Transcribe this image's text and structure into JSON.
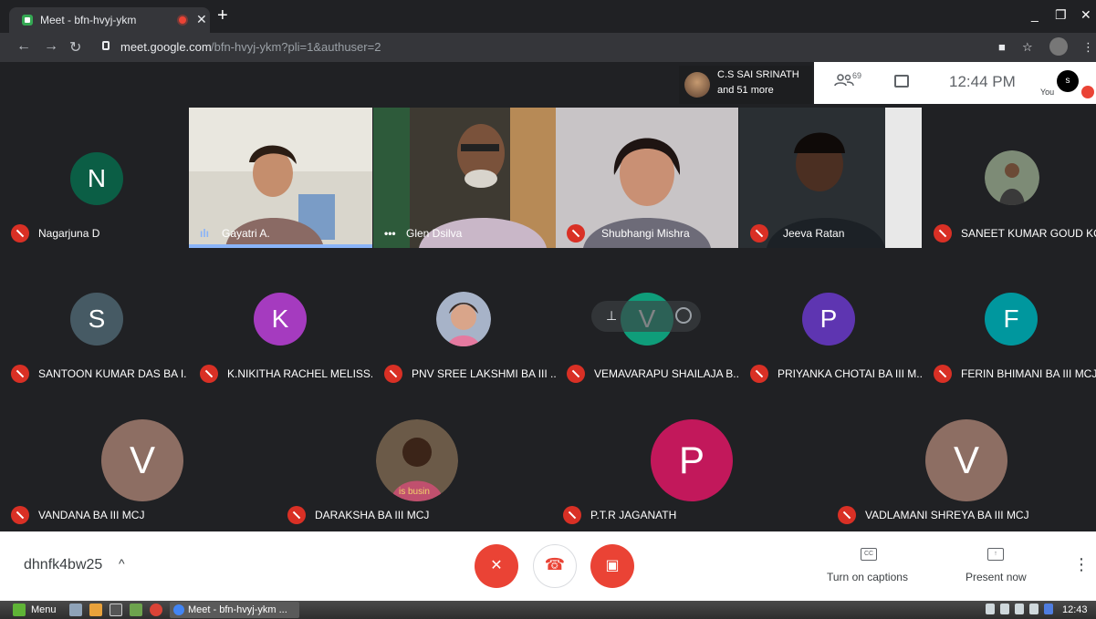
{
  "browser": {
    "tab_title": "Meet - bfn-hvyj-ykm",
    "url_host": "meet.google.com",
    "url_path": "/bfn-hvyj-ykm?pli=1&authuser=2"
  },
  "header": {
    "speaker_name": "C.S SAI SRINATH",
    "speaker_more": "and 51 more",
    "people_count": "69",
    "time": "12:44 PM",
    "you_label": "You",
    "self_initial": "s"
  },
  "participants": [
    {
      "name": "Nagarjuna D",
      "initial": "N",
      "color": "#0b5e45"
    },
    {
      "name": "Gayatri A.",
      "video": true,
      "speaking": true
    },
    {
      "name": "Glen Dsilva",
      "video": true
    },
    {
      "name": "Shubhangi Mishra",
      "video": true
    },
    {
      "name": "Jeeva Ratan",
      "video": true
    },
    {
      "name": "SANEET KUMAR GOUD KO...",
      "photo": true
    },
    {
      "name": "SANTOON KUMAR DAS BA I...",
      "initial": "S",
      "color": "#465a64"
    },
    {
      "name": "K.NIKITHA RACHEL MELISS...",
      "initial": "K",
      "color": "#a53bbf"
    },
    {
      "name": "PNV SREE LAKSHMI BA III ...",
      "photo": true
    },
    {
      "name": "VEMAVARAPU SHAILAJA B...",
      "initial": "V",
      "color": "#0f9d7a"
    },
    {
      "name": "PRIYANKA CHOTAI BA III M...",
      "initial": "P",
      "color": "#5e35b1"
    },
    {
      "name": "FERIN BHIMANI BA III MCJ",
      "initial": "F",
      "color": "#00979e"
    },
    {
      "name": "VANDANA BA III MCJ",
      "initial": "V",
      "color": "#8d6e63"
    },
    {
      "name": "DARAKSHA BA III MCJ",
      "photo": true,
      "caption": "is busin"
    },
    {
      "name": "P.T.R JAGANATH",
      "initial": "P",
      "color": "#c2185b"
    },
    {
      "name": "VADLAMANI SHREYA BA III MCJ",
      "initial": "V",
      "color": "#8d6e63"
    }
  ],
  "controls": {
    "meeting_code": "dhnfk4bw25",
    "captions_label": "Turn on captions",
    "captions_icon": "CC",
    "present_label": "Present now"
  },
  "taskbar": {
    "menu_label": "Menu",
    "window_label": "Meet - bfn-hvyj-ykm ...",
    "clock": "12:43"
  },
  "colors": {
    "background": "#202124",
    "mute_red": "#d93025",
    "control_red": "#ea4335"
  }
}
